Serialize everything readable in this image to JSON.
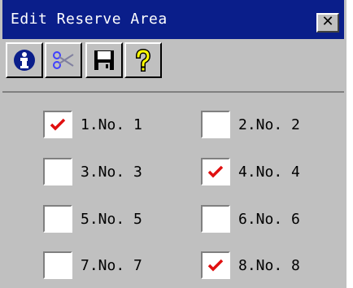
{
  "window": {
    "title": "Edit Reserve Area",
    "close_label": "✕"
  },
  "toolbar": {
    "buttons": [
      {
        "name": "info",
        "icon": "info-icon"
      },
      {
        "name": "cut",
        "icon": "scissors-icon"
      },
      {
        "name": "save",
        "icon": "floppy-disk-icon"
      },
      {
        "name": "help",
        "icon": "question-mark-icon"
      }
    ]
  },
  "colors": {
    "titlebar": "#0a1e8a",
    "face": "#c0c0c0",
    "check": "#e01010"
  },
  "items": [
    {
      "label": "1.No. 1",
      "checked": true
    },
    {
      "label": "2.No. 2",
      "checked": false
    },
    {
      "label": "3.No. 3",
      "checked": false
    },
    {
      "label": "4.No. 4",
      "checked": true
    },
    {
      "label": "5.No. 5",
      "checked": false
    },
    {
      "label": "6.No. 6",
      "checked": false
    },
    {
      "label": "7.No. 7",
      "checked": false
    },
    {
      "label": "8.No. 8",
      "checked": true
    }
  ]
}
